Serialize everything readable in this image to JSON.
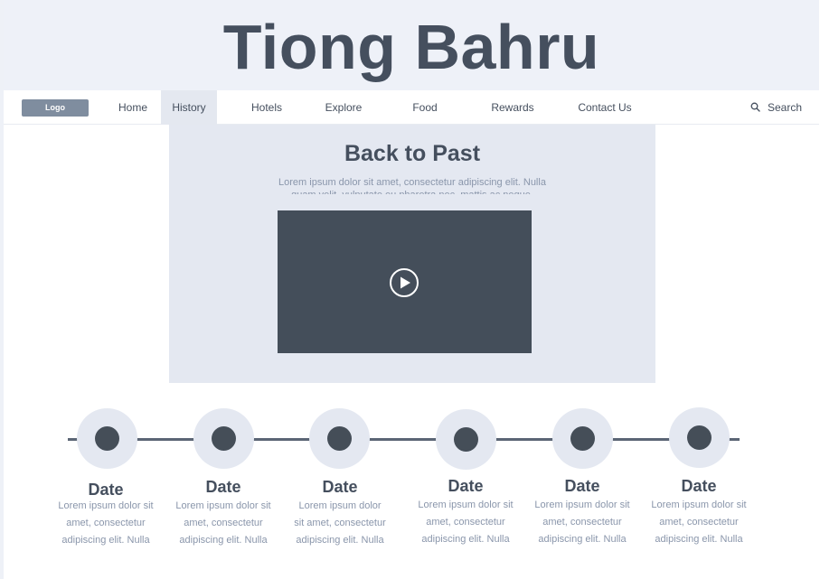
{
  "site": {
    "title": "Tiong Bahru"
  },
  "nav": {
    "logo": "Logo",
    "items": [
      {
        "label": "Home"
      },
      {
        "label": "History",
        "active": true
      },
      {
        "label": "Hotels"
      },
      {
        "label": "Explore"
      },
      {
        "label": "Food"
      },
      {
        "label": "Rewards"
      },
      {
        "label": "Contact Us"
      }
    ],
    "search_label": "Search"
  },
  "hero": {
    "title": "Back to Past",
    "text": "Lorem ipsum dolor sit amet, consectetur adipiscing elit. Nulla quam velit, vulputate eu pharetra nec, mattis ac neque.",
    "video_icon": "play-icon"
  },
  "timeline": {
    "items": [
      {
        "date": "Date",
        "lines": [
          "Lorem ipsum dolor sit",
          "amet, consectetur",
          "adipiscing elit. Nulla"
        ]
      },
      {
        "date": "Date",
        "lines": [
          "Lorem ipsum dolor sit",
          "amet, consectetur",
          "adipiscing elit. Nulla"
        ]
      },
      {
        "date": "Date",
        "lines": [
          "Lorem ipsum dolor",
          "sit amet, consectetur",
          "adipiscing elit. Nulla"
        ]
      },
      {
        "date": "Date",
        "lines": [
          "Lorem ipsum dolor sit",
          "amet, consectetur",
          "adipiscing elit. Nulla"
        ]
      },
      {
        "date": "Date",
        "lines": [
          "Lorem ipsum dolor sit",
          "amet, consectetur",
          "adipiscing elit. Nulla"
        ]
      },
      {
        "date": "Date",
        "lines": [
          "Lorem ipsum dolor sit",
          "amet, consectetur",
          "adipiscing elit. Nulla"
        ]
      }
    ]
  },
  "colors": {
    "header_bg": "#eef1f8",
    "text_dark": "#454f5e",
    "text_muted": "#8a96ab",
    "panel_bg": "#e4e8f1",
    "video_bg": "#444e5a",
    "logo_bg": "#7f8d9f"
  }
}
